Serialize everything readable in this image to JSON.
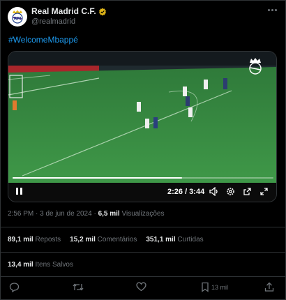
{
  "tweet": {
    "display_name": "Real Madrid C.F.",
    "handle": "@realmadrid",
    "text": "#WelcomeMbappé",
    "colors": {
      "accent": "#1d9bf0",
      "verified_gold": "#e2b719",
      "muted": "#71767b"
    }
  },
  "video": {
    "time_label": "2:26 / 3:44",
    "progress": 0.65,
    "watermark": "Real Madrid crest",
    "icons": [
      "pause-icon",
      "volume-icon",
      "settings-icon",
      "share-out-icon",
      "fullscreen-icon"
    ]
  },
  "meta": {
    "time": "2:56 PM",
    "sep": "·",
    "date": "3 de jun de 2024",
    "views_value": "6,5 mil",
    "views_label": "Visualizações"
  },
  "stats": {
    "reposts_value": "89,1 mil",
    "reposts_label": "Reposts",
    "comments_value": "15,2 mil",
    "comments_label": "Comentários",
    "likes_value": "351,1 mil",
    "likes_label": "Curtidas",
    "saves_value": "13,4 mil",
    "saves_label": "Itens Salvos"
  },
  "actions": {
    "bookmark_count": "13 mil",
    "icons": [
      "reply-icon",
      "repost-icon",
      "like-icon",
      "bookmark-icon",
      "share-icon"
    ]
  }
}
